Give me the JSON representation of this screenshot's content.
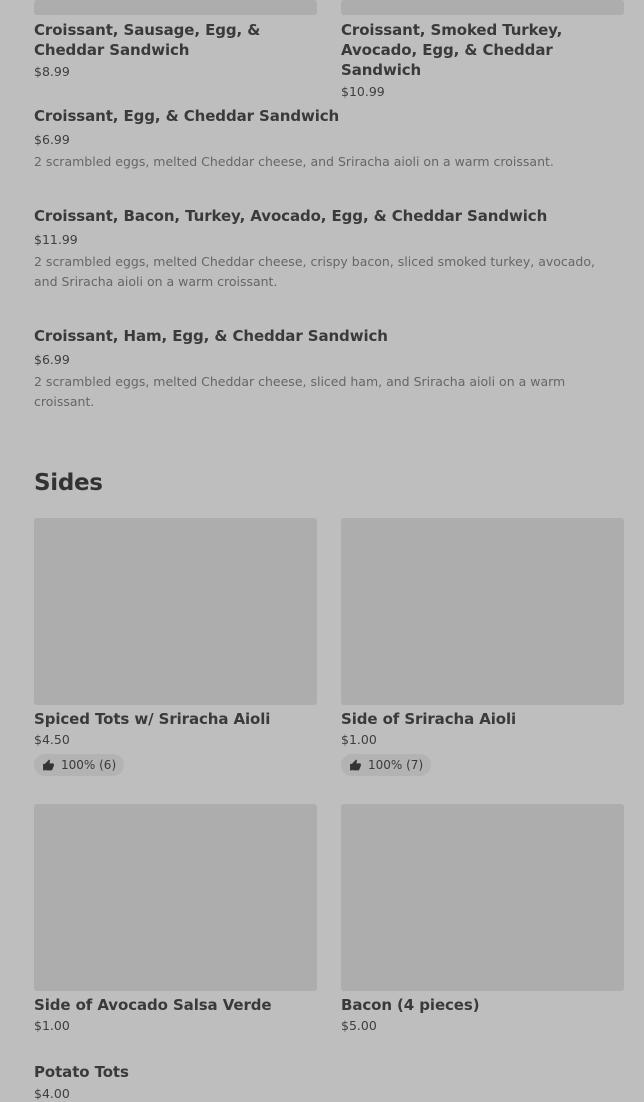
{
  "top_cards": [
    {
      "name": "Croissant, Sausage, Egg, & Cheddar Sandwich",
      "price": "$8.99"
    },
    {
      "name": "Croissant, Smoked Turkey, Avocado, Egg, & Cheddar Sandwich",
      "price": "$10.99"
    }
  ],
  "list_items": [
    {
      "name": "Croissant, Egg, & Cheddar Sandwich",
      "price": "$6.99",
      "description": "2 scrambled eggs, melted Cheddar cheese, and Sriracha aioli on a warm croissant."
    },
    {
      "name": "Croissant, Bacon, Turkey, Avocado, Egg, & Cheddar Sandwich",
      "price": "$11.99",
      "description": "2 scrambled eggs, melted Cheddar cheese, crispy bacon, sliced smoked turkey, avocado, and Sriracha aioli on a warm croissant."
    },
    {
      "name": "Croissant, Ham, Egg, & Cheddar Sandwich",
      "price": "$6.99",
      "description": "2 scrambled eggs, melted Cheddar cheese, sliced ham, and Sriracha aioli on a warm croissant."
    }
  ],
  "sides": {
    "title": "Sides",
    "cards": [
      {
        "name": "Spiced Tots w/ Sriracha Aioli",
        "price": "$4.50",
        "rating": "100% (6)",
        "rating_icon": "thumbs-up-icon"
      },
      {
        "name": "Side of Sriracha Aioli",
        "price": "$1.00",
        "rating": "100% (7)",
        "rating_icon": "thumbs-up-icon"
      },
      {
        "name": "Side of Avocado Salsa Verde",
        "price": "$1.00"
      },
      {
        "name": "Bacon (4 pieces)",
        "price": "$5.00"
      },
      {
        "name": "Potato Tots",
        "price": "$4.00"
      }
    ]
  }
}
